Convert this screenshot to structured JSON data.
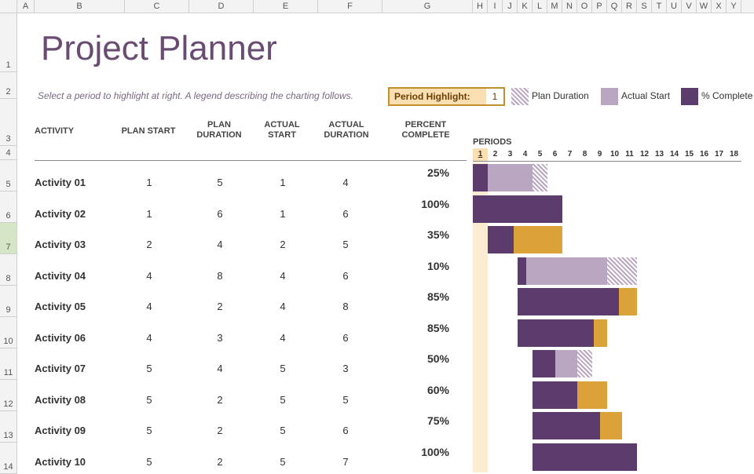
{
  "col_letters": [
    {
      "l": "",
      "w": 22
    },
    {
      "l": "A",
      "w": 22
    },
    {
      "l": "B",
      "w": 115
    },
    {
      "l": "C",
      "w": 82
    },
    {
      "l": "D",
      "w": 82
    },
    {
      "l": "E",
      "w": 82
    },
    {
      "l": "F",
      "w": 82
    },
    {
      "l": "G",
      "w": 115
    },
    {
      "l": "H",
      "w": 19
    },
    {
      "l": "I",
      "w": 19
    },
    {
      "l": "J",
      "w": 19
    },
    {
      "l": "K",
      "w": 19
    },
    {
      "l": "L",
      "w": 19
    },
    {
      "l": "M",
      "w": 19
    },
    {
      "l": "N",
      "w": 19
    },
    {
      "l": "O",
      "w": 19
    },
    {
      "l": "P",
      "w": 19
    },
    {
      "l": "Q",
      "w": 19
    },
    {
      "l": "R",
      "w": 19
    },
    {
      "l": "S",
      "w": 19
    },
    {
      "l": "T",
      "w": 19
    },
    {
      "l": "U",
      "w": 19
    },
    {
      "l": "V",
      "w": 19
    },
    {
      "l": "W",
      "w": 19
    },
    {
      "l": "X",
      "w": 19
    },
    {
      "l": "Y",
      "w": 19
    }
  ],
  "row_numbers": [
    {
      "n": "1",
      "h": 75,
      "sel": false
    },
    {
      "n": "2",
      "h": 34,
      "sel": false
    },
    {
      "n": "3",
      "h": 60,
      "sel": false
    },
    {
      "n": "4",
      "h": 18,
      "sel": false
    },
    {
      "n": "5",
      "h": 40,
      "sel": false
    },
    {
      "n": "6",
      "h": 40,
      "sel": false
    },
    {
      "n": "7",
      "h": 40,
      "sel": true
    },
    {
      "n": "8",
      "h": 40,
      "sel": false
    },
    {
      "n": "9",
      "h": 40,
      "sel": false
    },
    {
      "n": "10",
      "h": 40,
      "sel": false
    },
    {
      "n": "11",
      "h": 40,
      "sel": false
    },
    {
      "n": "12",
      "h": 40,
      "sel": false
    },
    {
      "n": "13",
      "h": 40,
      "sel": false
    },
    {
      "n": "14",
      "h": 40,
      "sel": false
    }
  ],
  "title": "Project Planner",
  "instruction": "Select a period to highlight at right.  A legend describing the charting follows.",
  "period_highlight_label": "Period Highlight:",
  "period_highlight_value": "1",
  "legend": {
    "plan_duration": "Plan Duration",
    "actual_start": "Actual Start",
    "pct_complete": "% Complete"
  },
  "headers": {
    "activity": "ACTIVITY",
    "plan_start": "PLAN START",
    "plan_duration": "PLAN DURATION",
    "actual_start": "ACTUAL START",
    "actual_duration": "ACTUAL DURATION",
    "percent_complete": "PERCENT COMPLETE",
    "periods": "PERIODS"
  },
  "periods": [
    "1",
    "2",
    "3",
    "4",
    "5",
    "6",
    "7",
    "8",
    "9",
    "10",
    "11",
    "12",
    "13",
    "14",
    "15",
    "16",
    "17",
    "18"
  ],
  "chart_data": {
    "type": "bar",
    "title": "Project Planner Gantt",
    "period_unit_width": 19,
    "highlighted_period": 1,
    "activities": [
      {
        "name": "Activity 01",
        "plan_start": 1,
        "plan_duration": 5,
        "actual_start": 1,
        "actual_duration": 4,
        "percent_complete": 25
      },
      {
        "name": "Activity 02",
        "plan_start": 1,
        "plan_duration": 6,
        "actual_start": 1,
        "actual_duration": 6,
        "percent_complete": 100
      },
      {
        "name": "Activity 03",
        "plan_start": 2,
        "plan_duration": 4,
        "actual_start": 2,
        "actual_duration": 5,
        "percent_complete": 35
      },
      {
        "name": "Activity 04",
        "plan_start": 4,
        "plan_duration": 8,
        "actual_start": 4,
        "actual_duration": 6,
        "percent_complete": 10
      },
      {
        "name": "Activity 05",
        "plan_start": 4,
        "plan_duration": 2,
        "actual_start": 4,
        "actual_duration": 8,
        "percent_complete": 85
      },
      {
        "name": "Activity 06",
        "plan_start": 4,
        "plan_duration": 3,
        "actual_start": 4,
        "actual_duration": 6,
        "percent_complete": 85
      },
      {
        "name": "Activity 07",
        "plan_start": 5,
        "plan_duration": 4,
        "actual_start": 5,
        "actual_duration": 3,
        "percent_complete": 50
      },
      {
        "name": "Activity 08",
        "plan_start": 5,
        "plan_duration": 2,
        "actual_start": 5,
        "actual_duration": 5,
        "percent_complete": 60
      },
      {
        "name": "Activity 09",
        "plan_start": 5,
        "plan_duration": 2,
        "actual_start": 5,
        "actual_duration": 6,
        "percent_complete": 75
      },
      {
        "name": "Activity 10",
        "plan_start": 5,
        "plan_duration": 2,
        "actual_start": 5,
        "actual_duration": 7,
        "percent_complete": 100
      }
    ]
  }
}
